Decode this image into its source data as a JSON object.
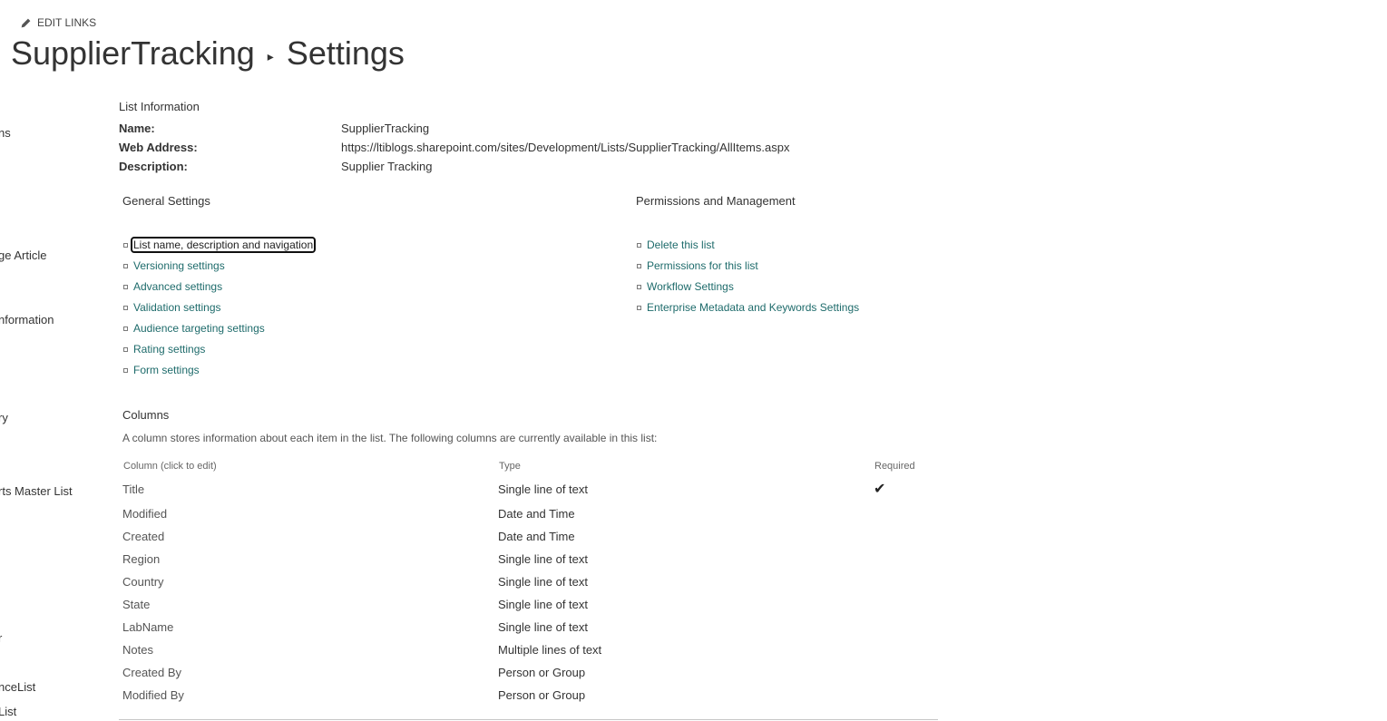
{
  "edit_links": {
    "label": "EDIT LINKS",
    "icon": "pencil-icon"
  },
  "title": {
    "list_name": "SupplierTracking",
    "separator": "▸",
    "page": "Settings"
  },
  "left_nav": [
    "ns",
    "ge Article",
    "nformation",
    "ry",
    "rts Master List",
    "r",
    "nceList",
    "List"
  ],
  "list_information": {
    "heading": "List Information",
    "name_label": "Name:",
    "name_value": "SupplierTracking",
    "web_label": "Web Address:",
    "web_value": "https://ltiblogs.sharepoint.com/sites/Development/Lists/SupplierTracking/AllItems.aspx",
    "desc_label": "Description:",
    "desc_value": "Supplier Tracking"
  },
  "general_settings": {
    "heading": "General Settings",
    "links": [
      "List name, description and navigation",
      "Versioning settings",
      "Advanced settings",
      "Validation settings",
      "Audience targeting settings",
      "Rating settings",
      "Form settings"
    ]
  },
  "permissions": {
    "heading": "Permissions and Management",
    "links": [
      "Delete this list",
      "Permissions for this list",
      "Workflow Settings",
      "Enterprise Metadata and Keywords Settings"
    ]
  },
  "columns": {
    "heading": "Columns",
    "description": "A column stores information about each item in the list. The following columns are currently available in this list:",
    "headers": {
      "name": "Column (click to edit)",
      "type": "Type",
      "required": "Required"
    },
    "rows": [
      {
        "name": "Title",
        "type": "Single line of text",
        "required": "✔"
      },
      {
        "name": "Modified",
        "type": "Date and Time",
        "required": ""
      },
      {
        "name": "Created",
        "type": "Date and Time",
        "required": ""
      },
      {
        "name": "Region",
        "type": "Single line of text",
        "required": ""
      },
      {
        "name": "Country",
        "type": "Single line of text",
        "required": ""
      },
      {
        "name": "State",
        "type": "Single line of text",
        "required": ""
      },
      {
        "name": "LabName",
        "type": "Single line of text",
        "required": ""
      },
      {
        "name": "Notes",
        "type": "Multiple lines of text",
        "required": ""
      },
      {
        "name": "Created By",
        "type": "Person or Group",
        "required": ""
      },
      {
        "name": "Modified By",
        "type": "Person or Group",
        "required": ""
      }
    ]
  }
}
